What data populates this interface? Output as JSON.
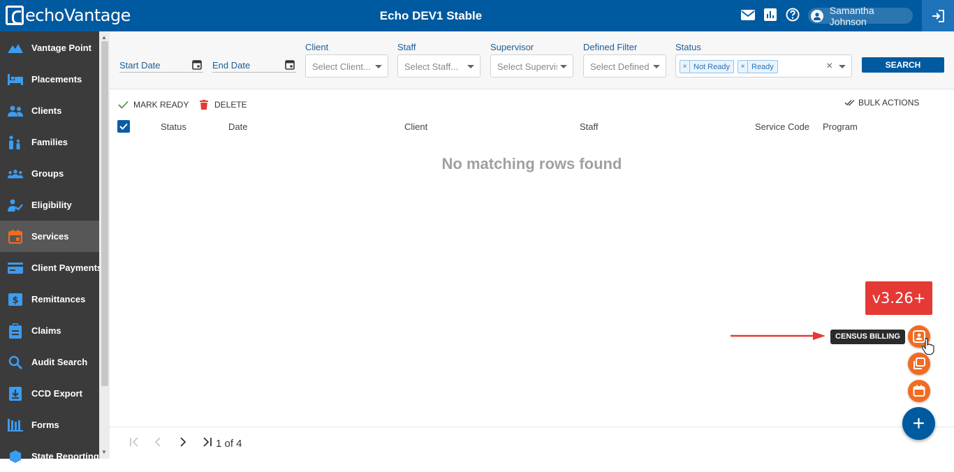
{
  "header": {
    "logo_text": "echoVantage",
    "title": "Echo DEV1 Stable",
    "user_name": "Samantha Johnson",
    "icons": [
      "mail-icon",
      "reports-icon",
      "help-icon",
      "user-icon",
      "logout-icon"
    ]
  },
  "sidebar": {
    "active": "Services",
    "items": [
      {
        "label": "Vantage Point",
        "icon": "mountain-icon"
      },
      {
        "label": "Placements",
        "icon": "bed-icon"
      },
      {
        "label": "Clients",
        "icon": "people-icon"
      },
      {
        "label": "Families",
        "icon": "family-icon"
      },
      {
        "label": "Groups",
        "icon": "groups-icon"
      },
      {
        "label": "Eligibility",
        "icon": "user-check-icon"
      },
      {
        "label": "Services",
        "icon": "calendar-icon"
      },
      {
        "label": "Client Payments",
        "icon": "payment-card-icon"
      },
      {
        "label": "Remittances",
        "icon": "remittance-icon"
      },
      {
        "label": "Claims",
        "icon": "clipboard-icon"
      },
      {
        "label": "Audit Search",
        "icon": "search-icon"
      },
      {
        "label": "CCD Export",
        "icon": "export-icon"
      },
      {
        "label": "Forms",
        "icon": "forms-icon"
      },
      {
        "label": "State Reporting",
        "icon": "state-icon"
      }
    ]
  },
  "filters": {
    "start_date": "Start Date",
    "end_date": "End Date",
    "client": {
      "label": "Client",
      "placeholder": "Select Client..."
    },
    "staff": {
      "label": "Staff",
      "placeholder": "Select Staff..."
    },
    "supervisor": {
      "label": "Supervisor",
      "placeholder": "Select Supervis..."
    },
    "defined_filter": {
      "label": "Defined Filter",
      "placeholder": "Select Defined ..."
    },
    "status": {
      "label": "Status",
      "tags": [
        "Not Ready",
        "Ready"
      ],
      "clear": "×"
    },
    "search_label": "SEARCH"
  },
  "actions": {
    "mark_ready": "MARK READY",
    "delete": "DELETE",
    "bulk_actions": "BULK ACTIONS"
  },
  "grid": {
    "columns": [
      "Status",
      "Date",
      "Client",
      "Staff",
      "Service Code",
      "Program"
    ],
    "empty_message": "No matching rows found"
  },
  "pager": {
    "page_text": "1 of 4"
  },
  "overlay": {
    "version": "v3.26+",
    "tooltip": "CENSUS BILLING",
    "fab_plus": "+"
  },
  "colors": {
    "brand_blue": "#005aa0",
    "sidebar_bg": "#3b3b3b",
    "accent_orange": "#f26b21",
    "version_red": "#e53935"
  }
}
